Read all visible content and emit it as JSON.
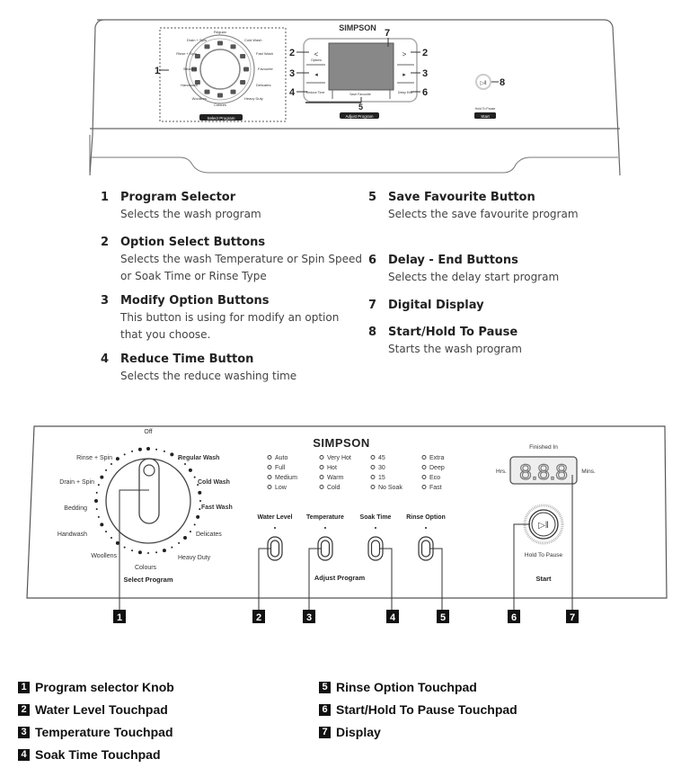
{
  "top_panel": {
    "brand": "SIMPSON",
    "dial_labels": [
      "Regular",
      "Cold Wash",
      "Fast Wash",
      "Favourite",
      "Delicates",
      "Heavy Duty",
      "Colours",
      "Woollens",
      "Handwash",
      "Bedding",
      "Rinse + Spin",
      "Drain + Spin"
    ],
    "select_program_label": "Select Program",
    "options_label": "Options",
    "reduce_time_label": "Reduce Time",
    "save_favourite_label": "Save Favourite",
    "delay_end_label": "Delay End",
    "adjust_program_label": "Adjust Program",
    "hold_to_pause_label": "Hold To Pause",
    "start_label": "Start",
    "callouts": [
      "1",
      "2",
      "2",
      "3",
      "3",
      "4",
      "5",
      "6",
      "7",
      "8"
    ]
  },
  "descriptions": [
    {
      "num": "1",
      "title": "Program Selector",
      "desc": [
        "Selects the wash program"
      ]
    },
    {
      "num": "2",
      "title": "Option Select Buttons",
      "desc": [
        "Selects the wash Temperature or Spin Speed",
        "or Soak Time or Rinse Type"
      ]
    },
    {
      "num": "3",
      "title": "Modify Option Buttons",
      "desc": [
        "This button is using for modify an option",
        "that you choose."
      ]
    },
    {
      "num": "4",
      "title": "Reduce Time Button",
      "desc": [
        "Selects the reduce washing time"
      ]
    },
    {
      "num": "5",
      "title": "Save Favourite Button",
      "desc": [
        "Selects the save favourite program"
      ]
    },
    {
      "num": "6",
      "title": "Delay - End Buttons",
      "desc": [
        "Selects the delay start program"
      ]
    },
    {
      "num": "7",
      "title": "Digital Display",
      "desc": []
    },
    {
      "num": "8",
      "title": "Start/Hold To Pause",
      "desc": [
        "Starts the wash program"
      ]
    }
  ],
  "bottom_panel": {
    "brand": "SIMPSON",
    "dial": {
      "off": "Off",
      "left": [
        "Rinse + Spin",
        "Drain + Spin",
        "Bedding",
        "Handwash",
        "Woollens"
      ],
      "right": [
        "Regular Wash",
        "Cold Wash",
        "Fast Wash",
        "Delicates",
        "Heavy Duty"
      ],
      "bottom": "Colours",
      "caption": "Select Program"
    },
    "option_columns": [
      {
        "label": "Water Level",
        "options": [
          "Auto",
          "Full",
          "Medium",
          "Low"
        ]
      },
      {
        "label": "Temperature",
        "options": [
          "Very Hot",
          "Hot",
          "Warm",
          "Cold"
        ]
      },
      {
        "label": "Soak Time",
        "options": [
          "45",
          "30",
          "15",
          "No Soak"
        ]
      },
      {
        "label": "Rinse Option",
        "options": [
          "Extra",
          "Deep",
          "Eco",
          "Fast"
        ]
      }
    ],
    "adjust_program_label": "Adjust Program",
    "finished_in_label": "Finished In",
    "hrs_label": "Hrs.",
    "mins_label": "Mins.",
    "display_value": "8.8.8",
    "hold_to_pause_label": "Hold To Pause",
    "start_label": "Start",
    "callouts": [
      "1",
      "2",
      "3",
      "4",
      "5",
      "6",
      "7"
    ]
  },
  "legend": [
    {
      "num": "1",
      "label": "Program selector Knob"
    },
    {
      "num": "2",
      "label": "Water Level Touchpad"
    },
    {
      "num": "3",
      "label": "Temperature Touchpad"
    },
    {
      "num": "4",
      "label": "Soak Time Touchpad"
    },
    {
      "num": "5",
      "label": "Rinse Option Touchpad"
    },
    {
      "num": "6",
      "label": "Start/Hold To Pause Touchpad"
    },
    {
      "num": "7",
      "label": "Display"
    }
  ]
}
